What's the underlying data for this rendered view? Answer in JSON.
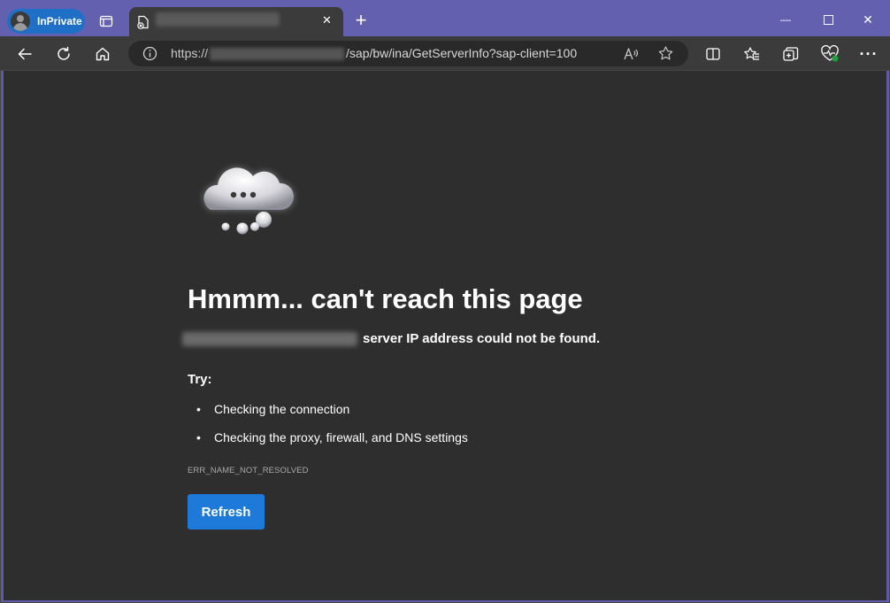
{
  "titlebar": {
    "inprivate_label": "InPrivate",
    "tab_close": "✕",
    "new_tab": "+",
    "minimize": "—",
    "maximize": "☐",
    "close": "✕"
  },
  "addressbar": {
    "url_prefix": "https://",
    "url_suffix": "/sap/bw/ina/GetServerInfo?sap-client=100",
    "more_menu": "···"
  },
  "error_page": {
    "heading": "Hmmm... can't reach this page",
    "message": "server IP address could not be found.",
    "try_label": "Try:",
    "suggestions": [
      "Checking the connection",
      "Checking the proxy, firewall, and DNS settings"
    ],
    "bullet": "•",
    "error_code": "ERR_NAME_NOT_RESOLVED",
    "refresh_label": "Refresh"
  },
  "colors": {
    "titlebar": "#6460b0",
    "toolbar": "#3b3b3b",
    "page_bg": "#2e2e2e",
    "accent": "#1e7ad9"
  }
}
